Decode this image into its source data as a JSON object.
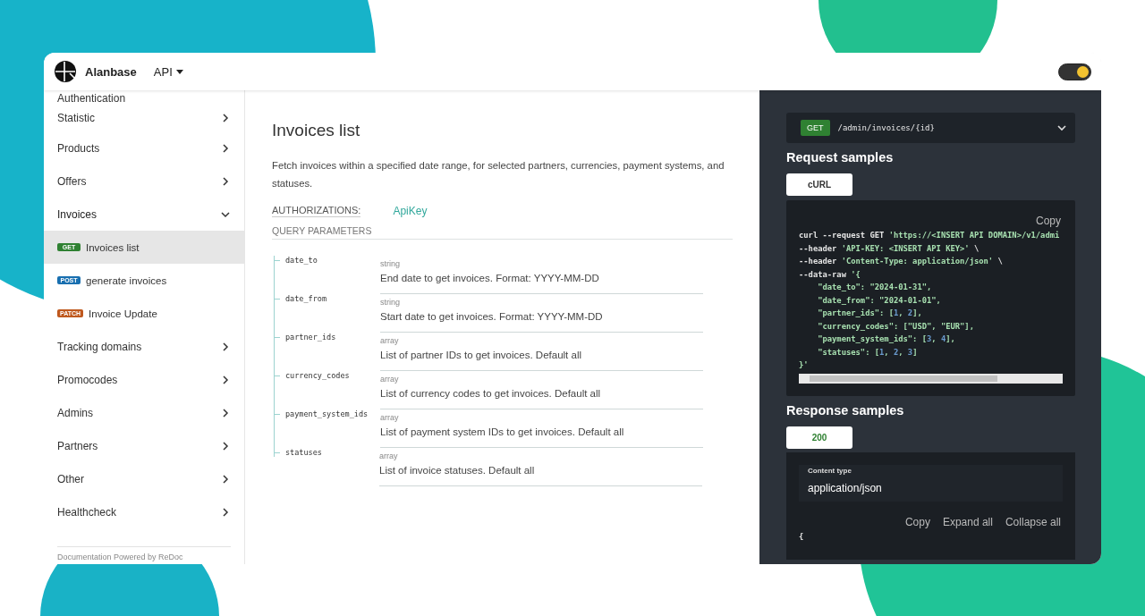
{
  "header": {
    "brand": "Alanbase",
    "menu": "API",
    "theme_toggle": {
      "on": true
    }
  },
  "sidebar": {
    "items": [
      {
        "kind": "clipped",
        "label": "Authentication"
      },
      {
        "kind": "group",
        "label": "Statistic",
        "expanded": false
      },
      {
        "kind": "group",
        "label": "Products",
        "expanded": false
      },
      {
        "kind": "group",
        "label": "Offers",
        "expanded": false
      },
      {
        "kind": "group",
        "label": "Invoices",
        "expanded": true
      },
      {
        "kind": "operation",
        "method": "GET",
        "label": "Invoices list",
        "selected": true
      },
      {
        "kind": "operation",
        "method": "POST",
        "label": "generate invoices",
        "selected": false
      },
      {
        "kind": "operation",
        "method": "PATCH",
        "label": "Invoice Update",
        "selected": false
      },
      {
        "kind": "group",
        "label": "Tracking domains",
        "expanded": false
      },
      {
        "kind": "group",
        "label": "Promocodes",
        "expanded": false
      },
      {
        "kind": "group",
        "label": "Admins",
        "expanded": false
      },
      {
        "kind": "group",
        "label": "Partners",
        "expanded": false
      },
      {
        "kind": "group",
        "label": "Other",
        "expanded": false
      },
      {
        "kind": "group",
        "label": "Healthcheck",
        "expanded": false
      }
    ],
    "footer": "Documentation Powered by ReDoc"
  },
  "operation": {
    "title": "Invoices list",
    "description": "Fetch invoices within a specified date range, for selected partners, currencies, payment systems, and statuses.",
    "authorizations_label": "AUTHORIZATIONS:",
    "authorization": "ApiKey",
    "query_parameters_label": "QUERY PARAMETERS",
    "parameters": [
      {
        "name": "date_to",
        "type": "string",
        "description": "End date to get invoices. Format: YYYY-MM-DD"
      },
      {
        "name": "date_from",
        "type": "string",
        "description": "Start date to get invoices. Format: YYYY-MM-DD"
      },
      {
        "name": "partner_ids",
        "type": "array",
        "description": "List of partner IDs to get invoices. Default all"
      },
      {
        "name": "currency_codes",
        "type": "array",
        "description": "List of currency codes to get invoices. Default all"
      },
      {
        "name": "payment_system_ids",
        "type": "array",
        "description": "List of payment system IDs to get invoices. Default all"
      },
      {
        "name": "statuses",
        "type": "array",
        "description": "List of invoice statuses. Default all"
      }
    ]
  },
  "samples": {
    "endpoint": {
      "method": "GET",
      "path": "/admin/invoices/{id}"
    },
    "request_title": "Request samples",
    "request_tabs": [
      {
        "label": "cURL",
        "selected": true
      }
    ],
    "copy": "Copy",
    "code": [
      [
        {
          "kind": "plain",
          "text": "curl --request GET "
        },
        {
          "kind": "string",
          "text": "'https://<INSERT API DOMAIN>/v1/admi"
        }
      ],
      [
        {
          "kind": "plain",
          "text": "--header "
        },
        {
          "kind": "string",
          "text": "'API-KEY: <INSERT API KEY>'"
        },
        {
          "kind": "plain",
          "text": " \\"
        }
      ],
      [
        {
          "kind": "plain",
          "text": "--header "
        },
        {
          "kind": "string",
          "text": "'Content-Type: application/json'"
        },
        {
          "kind": "plain",
          "text": " \\"
        }
      ],
      [
        {
          "kind": "plain",
          "text": "--data-raw "
        },
        {
          "kind": "string",
          "text": "'{"
        }
      ],
      [
        {
          "kind": "string",
          "text": "    \"date_to\": \"2024-01-31\","
        }
      ],
      [
        {
          "kind": "string",
          "text": "    \"date_from\": \"2024-01-01\","
        }
      ],
      [
        {
          "kind": "string",
          "text": "    \"partner_ids\": ["
        },
        {
          "kind": "number",
          "text": "1"
        },
        {
          "kind": "string",
          "text": ", "
        },
        {
          "kind": "number",
          "text": "2"
        },
        {
          "kind": "string",
          "text": "],"
        }
      ],
      [
        {
          "kind": "string",
          "text": "    \"currency_codes\": [\"USD\", \"EUR\"],"
        }
      ],
      [
        {
          "kind": "string",
          "text": "    \"payment_system_ids\": ["
        },
        {
          "kind": "number",
          "text": "3"
        },
        {
          "kind": "string",
          "text": ", "
        },
        {
          "kind": "number",
          "text": "4"
        },
        {
          "kind": "string",
          "text": "],"
        }
      ],
      [
        {
          "kind": "string",
          "text": "    \"statuses\": ["
        },
        {
          "kind": "number",
          "text": "1"
        },
        {
          "kind": "string",
          "text": ", "
        },
        {
          "kind": "number",
          "text": "2"
        },
        {
          "kind": "string",
          "text": ", "
        },
        {
          "kind": "number",
          "text": "3"
        },
        {
          "kind": "string",
          "text": "]"
        }
      ],
      [
        {
          "kind": "string",
          "text": "}'"
        }
      ]
    ],
    "response_title": "Response samples",
    "response_tabs": [
      {
        "label": "200",
        "selected": true
      }
    ],
    "content_type_label": "Content type",
    "content_type": "application/json",
    "response_actions": [
      "Copy",
      "Expand all",
      "Collapse all"
    ],
    "response_code": [
      "{"
    ]
  }
}
